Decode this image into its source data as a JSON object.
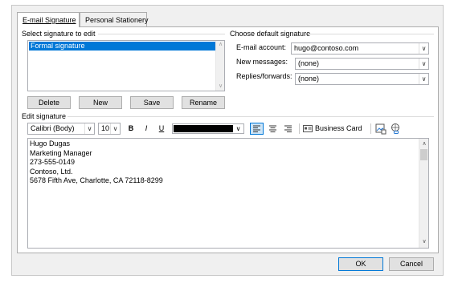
{
  "tabs": [
    {
      "label": "E-mail Signature",
      "active": true
    },
    {
      "label": "Personal Stationery",
      "active": false
    }
  ],
  "select_signature": {
    "label": "Select signature to edit",
    "items": [
      "Formal signature"
    ],
    "selected": "Formal signature"
  },
  "signature_buttons": {
    "delete": "Delete",
    "new": "New",
    "save": "Save",
    "rename": "Rename"
  },
  "default_signature": {
    "label": "Choose default signature",
    "email_account_label": "E-mail account:",
    "email_account_value": "hugo@contoso.com",
    "new_messages_label": "New messages:",
    "new_messages_value": "(none)",
    "replies_label": "Replies/forwards:",
    "replies_value": "(none)"
  },
  "edit_signature": {
    "label": "Edit signature",
    "font_name": "Calibri (Body)",
    "font_size": "10",
    "bold": "B",
    "italic": "I",
    "underline": "U",
    "font_color": "#000000",
    "business_card": "Business Card",
    "lines": [
      "Hugo Dugas",
      "Marketing Manager",
      "273-555-0149",
      "Contoso, Ltd.",
      "5678 Fifth Ave, Charlotte, CA 72118-8299"
    ]
  },
  "footer": {
    "ok": "OK",
    "cancel": "Cancel"
  },
  "colors": {
    "selection": "#0078d7",
    "dialog_bg": "#f0f0f0",
    "button_bg": "#e1e1e1"
  }
}
